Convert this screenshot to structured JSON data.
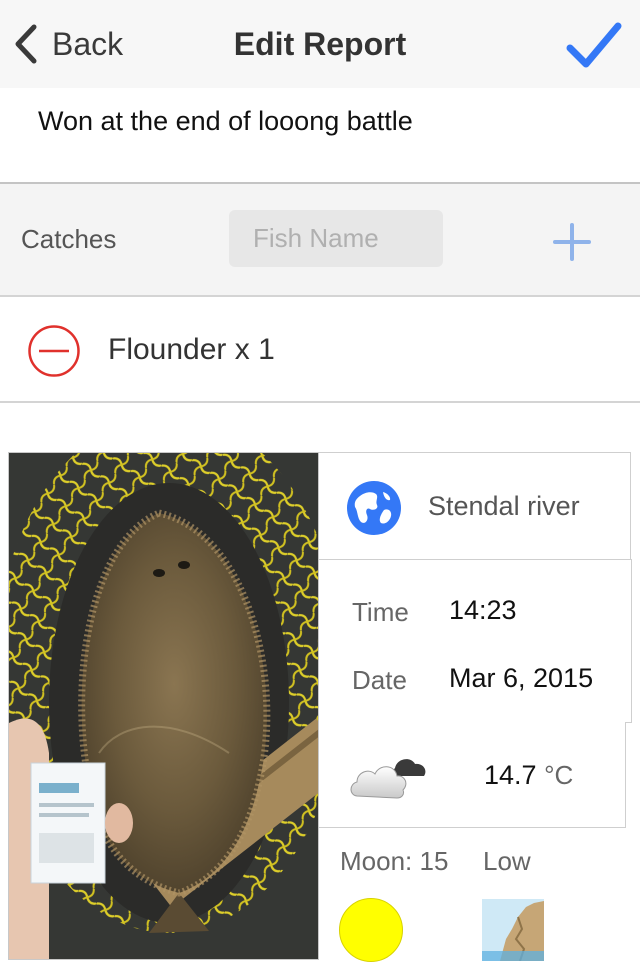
{
  "nav": {
    "back_label": "Back",
    "title": "Edit Report",
    "done_icon": "checkmark-icon"
  },
  "notes": {
    "text": "Won at the end of looong battle"
  },
  "catches": {
    "label": "Catches",
    "input_placeholder": "Fish Name",
    "input_value": "",
    "add_icon": "plus-icon",
    "items": [
      {
        "label": "Flounder x 1",
        "remove_icon": "minus-circle-icon"
      }
    ]
  },
  "photo": {
    "subject": "flounder on a yellow landing net"
  },
  "details": {
    "location_icon": "globe-icon",
    "location": "Stendal river",
    "time_label": "Time",
    "time_value": "14:23",
    "date_label": "Date",
    "date_value": "Mar 6, 2015",
    "weather_icon": "cloud-icon",
    "temperature": "14.7",
    "temperature_unit": "°C",
    "moon_label": "Moon: 15",
    "moon_icon": "full-moon-icon",
    "tide_label": "Low",
    "tide_icon": "low-tide-icon"
  },
  "colors": {
    "accent": "#3478f6",
    "remove": "#e0312c",
    "moon": "#ffff00",
    "net": "#e6d62a"
  }
}
